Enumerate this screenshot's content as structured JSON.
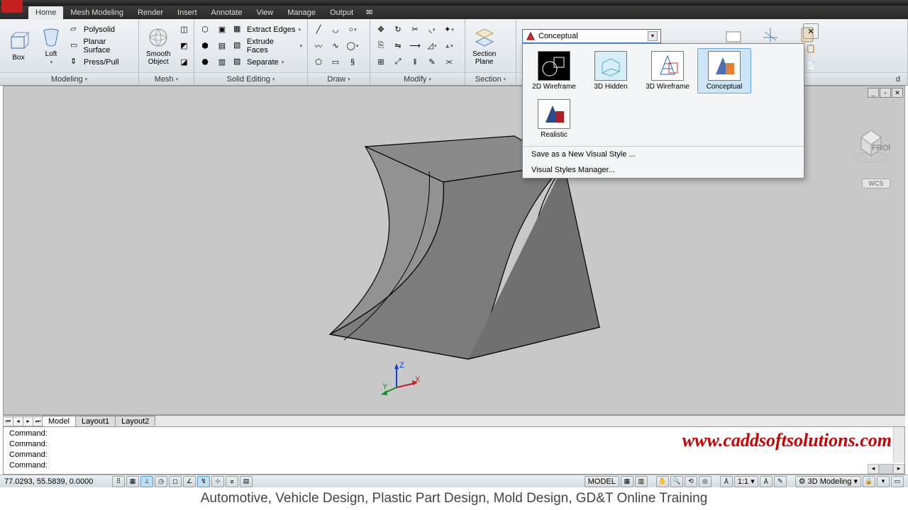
{
  "menu": {
    "items": [
      "Home",
      "Mesh Modeling",
      "Render",
      "Insert",
      "Annotate",
      "View",
      "Manage",
      "Output"
    ],
    "active": 0
  },
  "ribbon": {
    "modeling": {
      "box": "Box",
      "loft": "Loft",
      "polysolid": "Polysolid",
      "planar": "Planar Surface",
      "presspull": "Press/Pull",
      "footer": "Modeling"
    },
    "mesh": {
      "smooth": "Smooth\nObject",
      "footer": "Mesh"
    },
    "solid": {
      "extract": "Extract Edges",
      "extrude": "Extrude Faces",
      "separate": "Separate",
      "footer": "Solid Editing"
    },
    "draw": {
      "footer": "Draw"
    },
    "modify": {
      "footer": "Modify"
    },
    "section": {
      "plane": "Section\nPlane",
      "footer": "Section"
    },
    "right_footer": "d"
  },
  "visual_style": {
    "current": "Conceptual",
    "items": [
      "2D Wireframe",
      "3D Hidden",
      "3D Wireframe",
      "Conceptual",
      "Realistic"
    ],
    "selected_index": 3,
    "menu": [
      "Save as a New Visual Style ...",
      "Visual Styles Manager..."
    ]
  },
  "layout_tabs": [
    "Model",
    "Layout1",
    "Layout2"
  ],
  "command": {
    "lines": [
      "Command:",
      "Command:",
      "Command:",
      "Command:"
    ]
  },
  "watermark": "www.caddsoftsolutions.com",
  "status": {
    "coords": "77.0293, 55.5839, 0.0000",
    "model": "MODEL",
    "scale": "1:1",
    "workspace": "3D Modeling"
  },
  "wcs": "WCS",
  "training_text": "Automotive, Vehicle Design, Plastic Part Design, Mold Design, GD&T Online Training",
  "axes": {
    "x": "X",
    "y": "Y",
    "z": "Z"
  }
}
